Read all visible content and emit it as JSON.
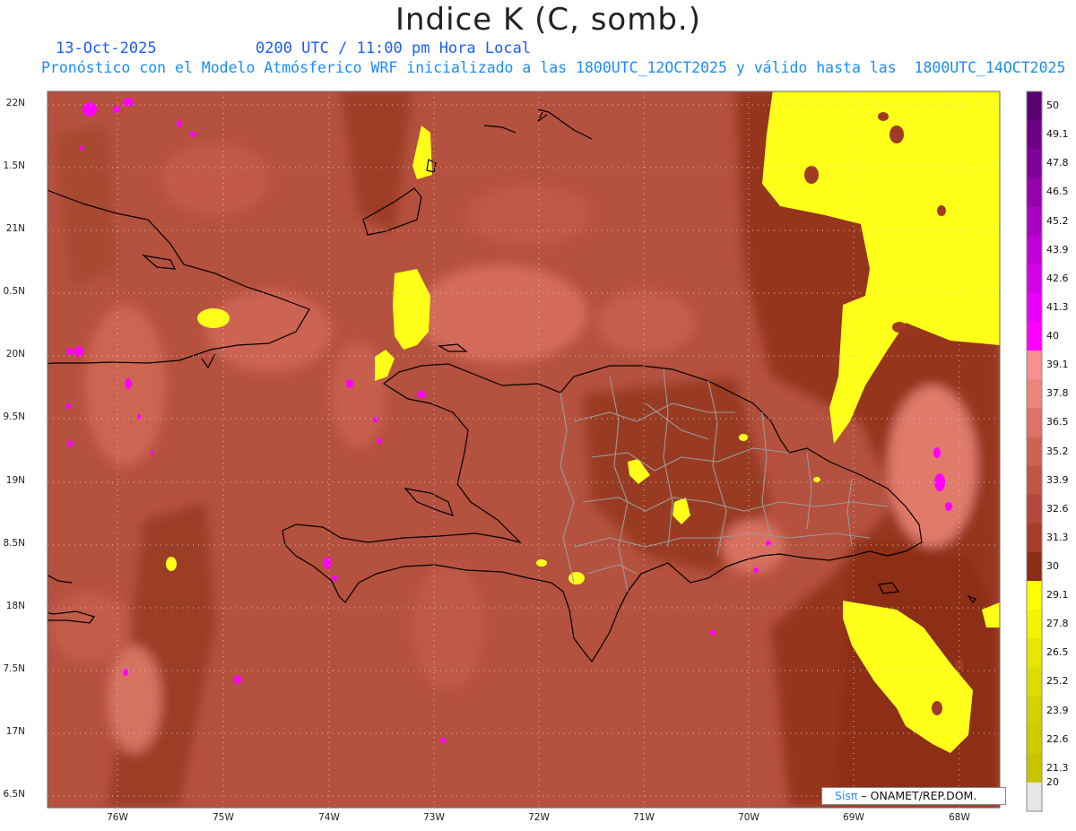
{
  "header": {
    "title": "Indice K (C, somb.)",
    "date": "13-Oct-2025",
    "time": "0200 UTC / 11:00 pm Hora Local",
    "subtitle": "Pronóstico con el Modelo Atmósferico WRF inicializado a las 1800UTC_12OCT2025 y válido hasta las  1800UTC_14OCT2025"
  },
  "axes": {
    "lat_labels": [
      "22N",
      "1.5N",
      "21N",
      "0.5N",
      "20N",
      "9.5N",
      "19N",
      "8.5N",
      "18N",
      "7.5N",
      "17N",
      "6.5N"
    ],
    "lon_labels": [
      "76W",
      "75W",
      "74W",
      "73W",
      "72W",
      "71W",
      "70W",
      "69W",
      "68W"
    ]
  },
  "colorbar": {
    "labels": [
      "50",
      "49.1",
      "47.8",
      "46.5",
      "45.2",
      "43.9",
      "42.6",
      "41.3",
      "40",
      "39.1",
      "37.8",
      "36.5",
      "35.2",
      "33.9",
      "32.6",
      "31.3",
      "30",
      "29.1",
      "27.8",
      "26.5",
      "25.2",
      "23.9",
      "22.6",
      "21.3",
      "20"
    ],
    "colors": [
      "#5a0070",
      "#6e0085",
      "#820099",
      "#9600ad",
      "#aa00c2",
      "#c000d6",
      "#d400e8",
      "#ea00f8",
      "#ff00ff",
      "#f89090",
      "#ec8478",
      "#de7264",
      "#d06254",
      "#c25446",
      "#b4483a",
      "#a63c2c",
      "#8a2e14",
      "#ffff00",
      "#f4f400",
      "#e6e600",
      "#dcdc00",
      "#d2d200",
      "#cccc00",
      "#c6c600",
      "#e6e6e6"
    ]
  },
  "credit": {
    "sis": "Sisπ",
    "org": " – ONAMET/REP.DOM."
  }
}
